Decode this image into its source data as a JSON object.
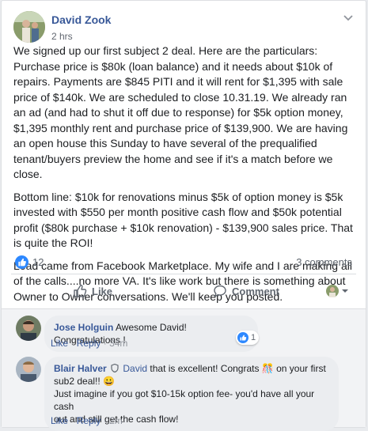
{
  "post": {
    "author": "David Zook",
    "timestamp": "2 hrs",
    "paragraphs": [
      "We signed up our first subject 2 deal. Here are the particulars: Purchase price is $80k (loan balance) and it needs about $10k of repairs. Payments are $845 PITI and it will rent for $1,395 with sale price of $140k. We are scheduled to close 10.31.19. We already ran an ad (and had to shut it off due to response) for $5k option money, $1,395 monthly rent and purchase price of $139,900. We are having an open house this Sunday to have several of the prequalified tenant/buyers preview the home and see if it's a match before we close.",
      "Bottom line: $10k for renovations minus $5k of option money is $5k invested with $550 per month positive cash flow and $50k potential profit ($80k purchase + $10k renovation) - $139,900 sales price. That is quite the ROI!",
      "Lead came from Facebook Marketplace. My wife and I are making all of the calls....no more VA. It's like work but there is something about Owner to Owner conversations. We'll keep you posted."
    ],
    "like_count": "12",
    "comments_count": "3 comments"
  },
  "actions": {
    "like": "Like",
    "comment": "Comment"
  },
  "comments": [
    {
      "author": "Jose Holguin",
      "text": " Awesome David! Congratulations !",
      "like_label": "Like",
      "reply_label": "Reply",
      "time": "34m",
      "reaction_count": "1"
    },
    {
      "author": "Blair Halver",
      "mention": "David",
      "text_line1": " that is excellent! Congrats 🎊 on your first",
      "text_line2": "sub2 deal!! 😀",
      "text_line3": "Just imagine if you got $10-15k option fee- you'd have all your cash",
      "text_line4": "out and still get the cash flow!",
      "like_label": "Like",
      "reply_label": "Reply",
      "time": "2m"
    }
  ],
  "colors": {
    "link": "#385898",
    "like_blue": "#2d88ff",
    "muted": "#606770"
  }
}
